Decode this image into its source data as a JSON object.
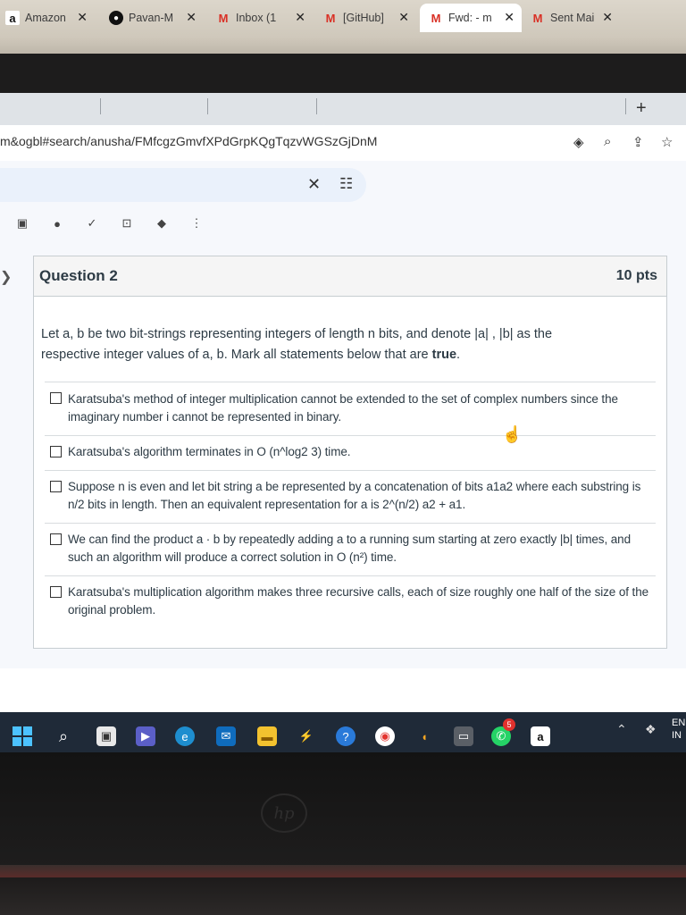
{
  "tabs": [
    {
      "label": "Amazon",
      "favicon": "amazon-icon"
    },
    {
      "label": "Pavan-M",
      "favicon": "github-icon"
    },
    {
      "label": "Inbox (1",
      "favicon": "gmail-icon"
    },
    {
      "label": "[GitHub]",
      "favicon": "gmail-icon"
    },
    {
      "label": "Fwd: - m",
      "favicon": "gmail-icon",
      "active": true
    },
    {
      "label": "Sent Mai",
      "favicon": "gmail-icon"
    }
  ],
  "address": {
    "url": "m&ogbl#search/anusha/FMfcgzGmvfXPdGrpKQgTqzvWGSzGjDnM"
  },
  "question": {
    "title": "Question 2",
    "points": "10 pts",
    "prompt_1": "Let a, b be two bit-strings representing integers of length n bits, and denote |a| , |b| as the",
    "prompt_2": "respective integer values of a, b. Mark all statements below that are",
    "prompt_bold": "true",
    "prompt_end": ".",
    "answers": [
      "Karatsuba's method of integer multiplication cannot be extended to the set of complex numbers since the imaginary number i cannot be represented in binary.",
      "Karatsuba's algorithm terminates in O (n^log2 3) time.",
      "Suppose n is even and let bit string a be represented by a concatenation of bits a1a2 where each substring is n/2 bits in length. Then an equivalent representation for a is 2^(n/2) a2 + a1.",
      "We can find the product a · b by repeatedly adding a to a running sum starting at zero exactly |b| times, and such an algorithm will produce a correct solution in O (n²) time.",
      "Karatsuba's multiplication algorithm makes three recursive calls, each of size roughly one half of the size of the original problem."
    ]
  },
  "taskbar": {
    "whatsapp_badge": "5",
    "lang_1": "EN",
    "lang_2": "IN"
  },
  "colors": {
    "gmail_red": "#d93025",
    "taskbar": "#1f2a38",
    "canvas_text": "#2d3b45"
  }
}
